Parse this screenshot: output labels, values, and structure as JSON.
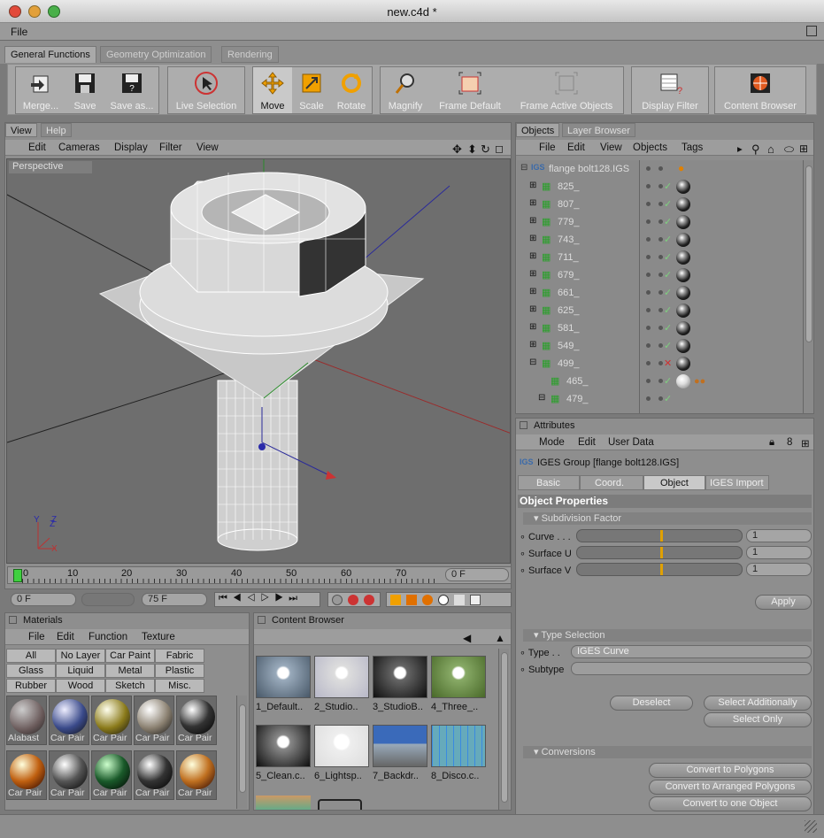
{
  "window": {
    "title": "new.c4d *"
  },
  "menu": {
    "file": "File"
  },
  "tabs": [
    "General Functions",
    "Geometry Optimization",
    "Rendering"
  ],
  "toolbar": {
    "merge": "Merge...",
    "save": "Save",
    "save_as": "Save as...",
    "live_selection": "Live Selection",
    "move": "Move",
    "scale": "Scale",
    "rotate": "Rotate",
    "magnify": "Magnify",
    "frame_default": "Frame Default",
    "frame_active": "Frame Active Objects",
    "display_filter": "Display Filter",
    "content_browser": "Content Browser"
  },
  "view": {
    "tab": "View",
    "tab2": "Help",
    "menu": [
      "Edit",
      "Cameras",
      "Display",
      "Filter",
      "View"
    ],
    "label": "Perspective"
  },
  "timeline": {
    "ticks": [
      "0",
      "10",
      "20",
      "30",
      "40",
      "50",
      "60",
      "70"
    ],
    "current": "0 F",
    "start": "0 F",
    "end": "75 F",
    "right": "0 F"
  },
  "objects": {
    "tab": "Objects",
    "tab2": "Layer Browser",
    "menu": [
      "File",
      "Edit",
      "View",
      "Objects",
      "Tags"
    ],
    "root": "flange bolt128.IGS",
    "rows": [
      "825_",
      "807_",
      "779_",
      "743_",
      "711_",
      "679_",
      "661_",
      "625_",
      "581_",
      "549_",
      "499_",
      "465_",
      "479_"
    ]
  },
  "attributes": {
    "header": "Attributes",
    "menu": [
      "Mode",
      "Edit",
      "User Data"
    ],
    "object_title": "IGES Group [flange bolt128.IGS]",
    "tabs": [
      "Basic",
      "Coord.",
      "Object",
      "IGES Import"
    ],
    "section": "Object Properties",
    "sub1": "Subdivision Factor",
    "curve": "Curve . . .",
    "surface_u": "Surface U",
    "surface_v": "Surface V",
    "curve_val": "1",
    "su_val": "1",
    "sv_val": "1",
    "apply": "Apply",
    "sub2": "Type Selection",
    "type": "Type . .",
    "subtype": "Subtype",
    "type_val": "IGES Curve",
    "subtype_val": "",
    "deselect": "Deselect",
    "select_additionally": "Select Additionally",
    "select_only": "Select Only",
    "sub3": "Conversions",
    "conv1": "Convert to Polygons",
    "conv2": "Convert to Arranged Polygons",
    "conv3": "Convert to one Object"
  },
  "materials": {
    "header": "Materials",
    "menu": [
      "File",
      "Edit",
      "Function",
      "Texture"
    ],
    "cats": [
      "All",
      "No Layer",
      "Car Paint",
      "Fabric",
      "Glass",
      "Liquid",
      "Metal",
      "Plastic",
      "Rubber",
      "Wood",
      "Sketch",
      "Misc."
    ],
    "items": [
      "Alabast",
      "Car Pair",
      "Car Pair",
      "Car Pair",
      "Car Pair",
      "Car Pair",
      "Car Pair",
      "Car Pair",
      "Car Pair",
      "Car Pair"
    ]
  },
  "content": {
    "header": "Content Browser",
    "items": [
      "1_Default..",
      "2_Studio..",
      "3_StudioB..",
      "4_Three_..",
      "5_Clean.c..",
      "6_Lightsp..",
      "7_Backdr..",
      "8_Disco.c.."
    ]
  }
}
